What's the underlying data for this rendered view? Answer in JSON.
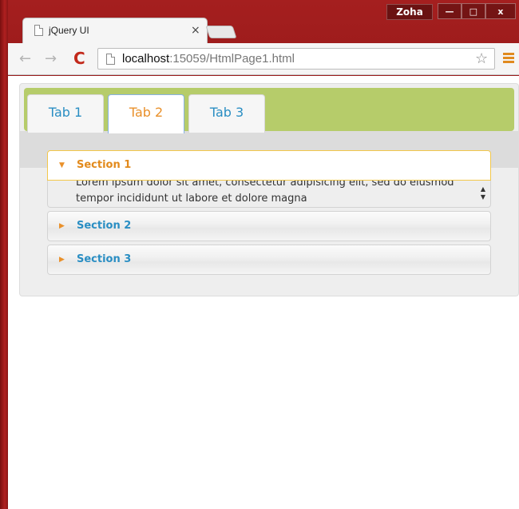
{
  "window": {
    "user_name": "Zoha",
    "min_label": "—",
    "max_label": "□",
    "close_label": "x"
  },
  "browser_tab": {
    "title": "jQuery UI",
    "close_label": "×"
  },
  "toolbar": {
    "back_icon": "←",
    "forward_icon": "→",
    "reload_icon": "C",
    "url_host": "localhost",
    "url_rest": ":15059/HtmlPage1.html",
    "star_icon": "☆"
  },
  "tabs": [
    {
      "label": "Tab 1",
      "active": false
    },
    {
      "label": "Tab 2",
      "active": true
    },
    {
      "label": "Tab 3",
      "active": false
    }
  ],
  "accordion": {
    "sections": [
      {
        "label": "Section 1",
        "active": true,
        "arrow": "▼"
      },
      {
        "label": "Section 2",
        "active": false,
        "arrow": "▶"
      },
      {
        "label": "Section 3",
        "active": false,
        "arrow": "▶"
      }
    ],
    "content_text": "Lorem ipsum dolor sit amet, consectetur adipisicing elit, sed do eiusmod tempor incididunt ut labore et dolore magna"
  },
  "colors": {
    "tab_bar_accent": "#b6cc6a",
    "link_blue": "#2a8ec3",
    "active_orange": "#e9902a"
  }
}
